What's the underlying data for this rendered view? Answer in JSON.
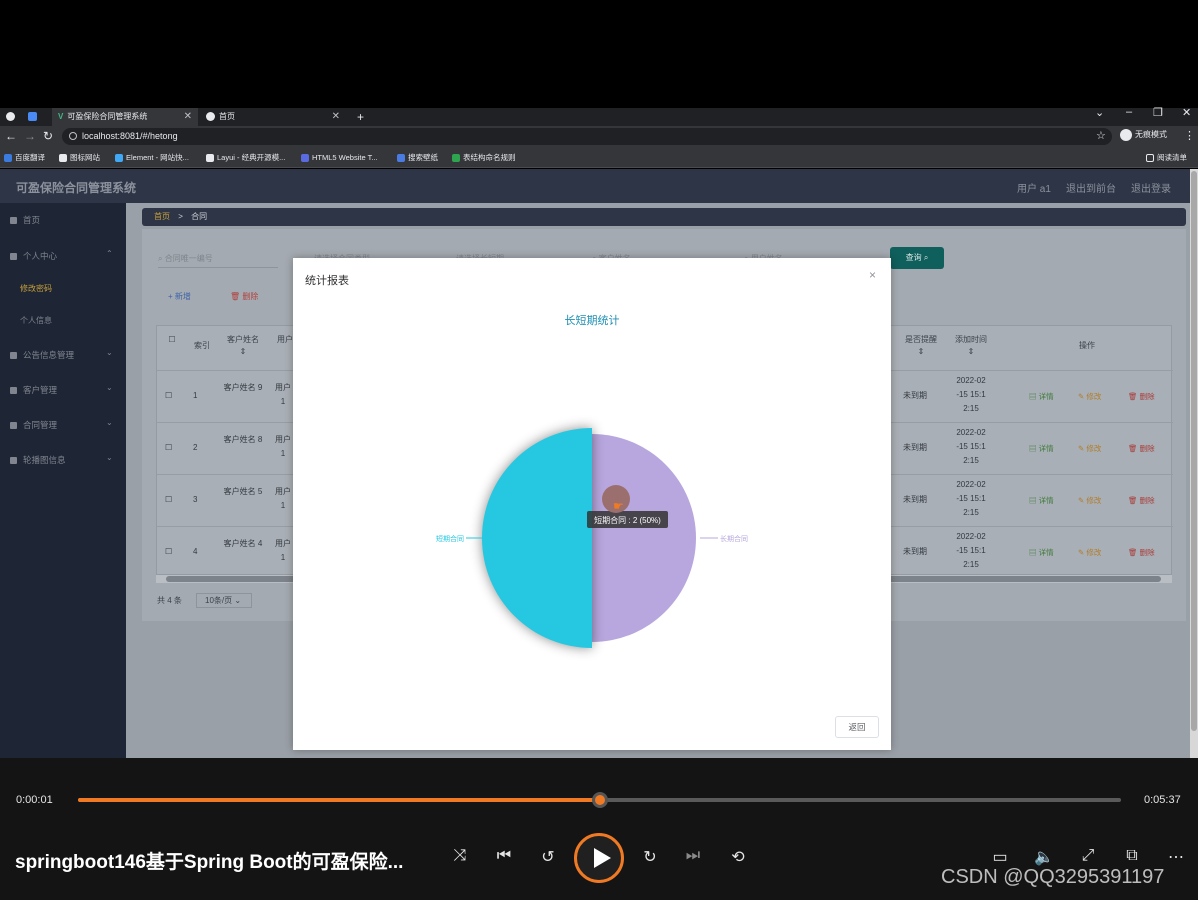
{
  "browser": {
    "tabs": [
      {
        "label": "可盈保险合同管理系统",
        "active": true
      },
      {
        "label": "首页",
        "active": false
      }
    ],
    "new_tab": "+",
    "window_controls": {
      "dropdown": "⌄",
      "minimize": "–",
      "restore": "❐",
      "close": "✕"
    },
    "url": "localhost:8081/#/hetong",
    "profile": "无痕模式",
    "bookmarks": [
      {
        "label": "百度翻译",
        "color": "#3a7be0"
      },
      {
        "label": "图标网站",
        "color": "#e8eaed"
      },
      {
        "label": "Element - 网站快...",
        "color": "#3fa9f5"
      },
      {
        "label": "Layui - 经典开源模...",
        "color": "#e8eaed"
      },
      {
        "label": "HTML5 Website T...",
        "color": "#5a6ae0"
      },
      {
        "label": "搜索壁纸",
        "color": "#4a7be0"
      },
      {
        "label": "表结构命名规则",
        "color": "#2ea44f"
      }
    ],
    "reading_list": "阅读清单"
  },
  "app": {
    "title": "可盈保险合同管理系统",
    "top_links": [
      "用户 a1",
      "退出到前台",
      "退出登录"
    ],
    "sidebar": [
      {
        "label": "首页",
        "type": "item"
      },
      {
        "label": "个人中心",
        "type": "group",
        "expanded": true
      },
      {
        "label": "修改密码",
        "type": "sub",
        "active": true
      },
      {
        "label": "个人信息",
        "type": "sub"
      },
      {
        "label": "公告信息管理",
        "type": "group"
      },
      {
        "label": "客户管理",
        "type": "group"
      },
      {
        "label": "合同管理",
        "type": "group"
      },
      {
        "label": "轮播图信息",
        "type": "group"
      }
    ],
    "breadcrumb": {
      "home": "首页",
      "sep": ">",
      "current": "合同"
    },
    "search": {
      "placeholders": [
        "合同唯一编号",
        "请选择合同类型",
        "请选择长短期",
        "客户姓名",
        "用户姓名"
      ],
      "query_label": "查询"
    },
    "actions": {
      "add": "+ 新增",
      "delete": "删除"
    },
    "table": {
      "headers": {
        "index": "索引",
        "customer": "客户姓名",
        "user": "用户",
        "remind": "是否提醒",
        "added": "添加时间",
        "ops": "操作"
      },
      "rows": [
        {
          "index": "1",
          "customer": "客户姓名 9",
          "user": "用户 1",
          "remind": "未到期",
          "time": "2022-02 -15 15:1 2:15"
        },
        {
          "index": "2",
          "customer": "客户姓名 8",
          "user": "用户 1",
          "remind": "未到期",
          "time": "2022-02 -15 15:1 2:15"
        },
        {
          "index": "3",
          "customer": "客户姓名 5",
          "user": "用户 1",
          "remind": "未到期",
          "time": "2022-02 -15 15:1 2:15"
        },
        {
          "index": "4",
          "customer": "客户姓名 4",
          "user": "用户 1",
          "remind": "未到期",
          "time": "2022-02 -15 15:1 2:15"
        }
      ],
      "ops": {
        "detail": "详情",
        "edit": "修改",
        "delete": "删除"
      }
    },
    "pagination": {
      "total": "共 4 条",
      "page_size": "10条/页"
    }
  },
  "modal": {
    "title": "统计报表",
    "close": "×",
    "back_label": "返回"
  },
  "chart_data": {
    "type": "pie",
    "title": "长短期统计",
    "slices": [
      {
        "name": "长期合同",
        "value": 2,
        "color": "#b8a7de"
      },
      {
        "name": "短期合同",
        "value": 2,
        "color": "#25c8e0"
      }
    ],
    "tooltip": "短期合同 : 2 (50%)",
    "highlighted": "短期合同"
  },
  "player": {
    "current_time": "0:00:01",
    "total_time": "0:05:37",
    "progress": 0.5,
    "title": "springboot146基于Spring Boot的可盈保险...",
    "watermark": "CSDN @QQ3295391197"
  }
}
